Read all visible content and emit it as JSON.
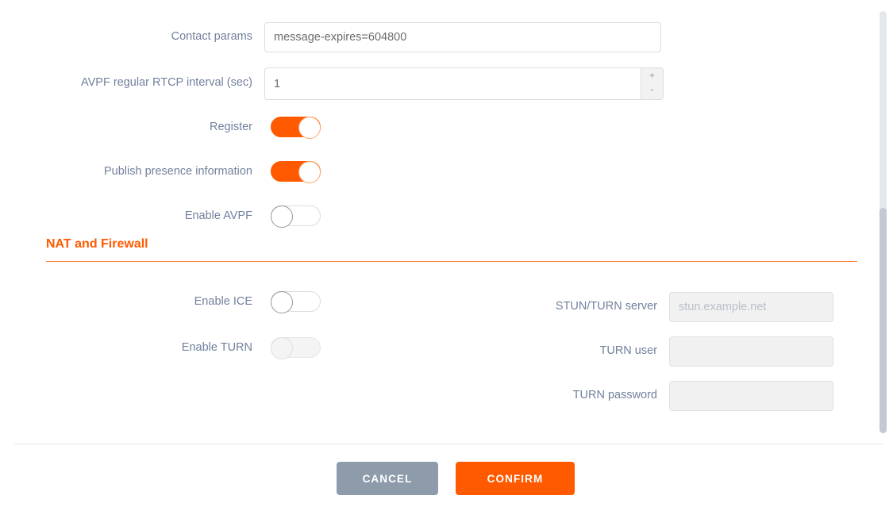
{
  "form": {
    "rows": [
      {
        "label": "Contact params",
        "control": "text",
        "value": "message-expires=604800",
        "placeholder": ""
      },
      {
        "label": "AVPF regular RTCP interval (sec)",
        "control": "number",
        "value": "1",
        "increment_label": "+",
        "decrement_label": "-"
      },
      {
        "label": "Register",
        "control": "toggle",
        "state": "on"
      },
      {
        "label": "Publish presence information",
        "control": "toggle",
        "state": "on"
      },
      {
        "label": "Enable AVPF",
        "control": "toggle",
        "state": "off"
      }
    ]
  },
  "section": {
    "title": "NAT and Firewall"
  },
  "nat": {
    "left_rows": [
      {
        "label": "Enable ICE",
        "control": "toggle",
        "state": "off"
      },
      {
        "label": "Enable TURN",
        "control": "toggle",
        "state": "disabled"
      }
    ],
    "right_rows": [
      {
        "label": "STUN/TURN server",
        "value": "",
        "placeholder": "stun.example.net"
      },
      {
        "label": "TURN user",
        "value": "",
        "placeholder": ""
      },
      {
        "label": "TURN password",
        "value": "",
        "placeholder": ""
      }
    ]
  },
  "footer": {
    "cancel_label": "CANCEL",
    "confirm_label": "CONFIRM"
  },
  "colors": {
    "accent": "#ff5a00",
    "label": "#72809d",
    "cancel": "#8e9bab"
  }
}
